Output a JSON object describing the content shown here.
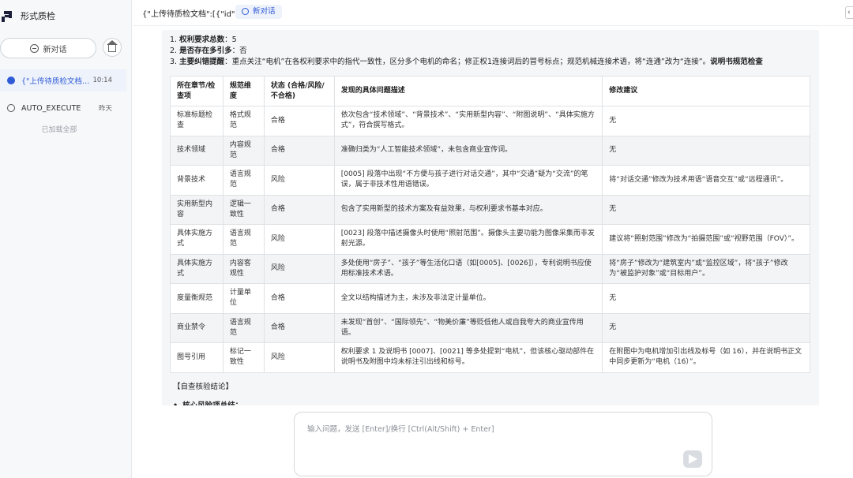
{
  "sidebar": {
    "app_title": "形式质检",
    "new_chat_label": "新对话",
    "conversations": [
      {
        "title": "{\"上传待质检文档\":[{\"...",
        "time": "10:14",
        "active": true
      },
      {
        "title": "AUTO_EXECUTE",
        "time": "昨天",
        "active": false
      }
    ],
    "loaded_all": "已加载全部"
  },
  "topbar": {
    "doc_title": "{\"上传待质检文档\":[{\"id\":\"v",
    "new_chat_tag": "新对话"
  },
  "findings": {
    "item1_prefix": "1. ",
    "item1_label": "权利要求总数",
    "item1_value": "：5",
    "item2_prefix": "2. ",
    "item2_label": "是否存在多引多",
    "item2_value": "：否",
    "item3_prefix": "3. ",
    "item3_label": "主要纠错提醒",
    "item3_value": "：重点关注“电机”在各权利要求中的指代一致性，区分多个电机的命名；修正权1连接词后的冒号标点；规范机械连接术语，将“连通”改为“连接”。",
    "item3_tail": "说明书规范检查"
  },
  "table": {
    "headers": {
      "h1": "所在章节/检查项",
      "h2": "规范维度",
      "h3": "状态 (合格/风险/不合格)",
      "h4": "发现的具体问题描述",
      "h5": "修改建议"
    },
    "rows": [
      {
        "section": "标准标题检查",
        "dimension": "格式规范",
        "status": "合格",
        "description": "依次包含“技术领域”、“背景技术”、“实用新型内容”、“附图说明”、“具体实施方式”，符合撰写格式。",
        "suggestion": "无"
      },
      {
        "section": "技术领域",
        "dimension": "内容规范",
        "status": "合格",
        "description": "准确归类为“人工智能技术领域”，未包含商业宣传词。",
        "suggestion": "无"
      },
      {
        "section": "背景技术",
        "dimension": "语言规范",
        "status": "风险",
        "description": "[0005] 段落中出现“不方便与孩子进行对话交通”，其中“交通”疑为“交流”的笔误，属于非技术性用语错误。",
        "suggestion": "将“对话交通”修改为技术用语“语音交互”或“远程通讯”。"
      },
      {
        "section": "实用新型内容",
        "dimension": "逻辑一致性",
        "status": "合格",
        "description": "包含了实用新型的技术方案及有益效果，与权利要求书基本对应。",
        "suggestion": "无"
      },
      {
        "section": "具体实施方式",
        "dimension": "语言规范",
        "status": "风险",
        "description": "[0023] 段落中描述摄像头时使用“照射范围”。摄像头主要功能为图像采集而非发射光源。",
        "suggestion": "建议将“照射范围”修改为“拍摄范围”或“视野范围（FOV）”。"
      },
      {
        "section": "具体实施方式",
        "dimension": "内容客观性",
        "status": "风险",
        "description": "多处使用“房子”、“孩子”等生活化口语（如[0005]、[0026]），专利说明书应使用标准技术术语。",
        "suggestion": "将“房子”修改为“建筑室内”或“监控区域”，将“孩子”修改为“被监护对象”或“目标用户”。"
      },
      {
        "section": "度量衡规范",
        "dimension": "计量单位",
        "status": "合格",
        "description": "全文以结构描述为主，未涉及非法定计量单位。",
        "suggestion": "无"
      },
      {
        "section": "商业禁令",
        "dimension": "语言规范",
        "status": "合格",
        "description": "未发现“首创”、“国际领先”、“物美价廉”等贬低他人或自我夸大的商业宣传用语。",
        "suggestion": "无"
      },
      {
        "section": "图号引用",
        "dimension": "标记一致性",
        "status": "风险",
        "description": "权利要求 1 及说明书 [0007]、[0021] 等多处提到“电机”，但该核心驱动部件在说明书及附图中均未标注引出线和标号。",
        "suggestion": "在附图中为电机增加引出线及标号（如 16），并在说明书正文中同步更新为“电机（16）”。"
      }
    ]
  },
  "verify": {
    "title": "【自查核验结论】",
    "risk_summary": "核心风险项总结："
  },
  "input": {
    "placeholder": "输入问题，发送 [Enter]/换行 [Ctrl(Alt/Shift) + Enter]"
  }
}
